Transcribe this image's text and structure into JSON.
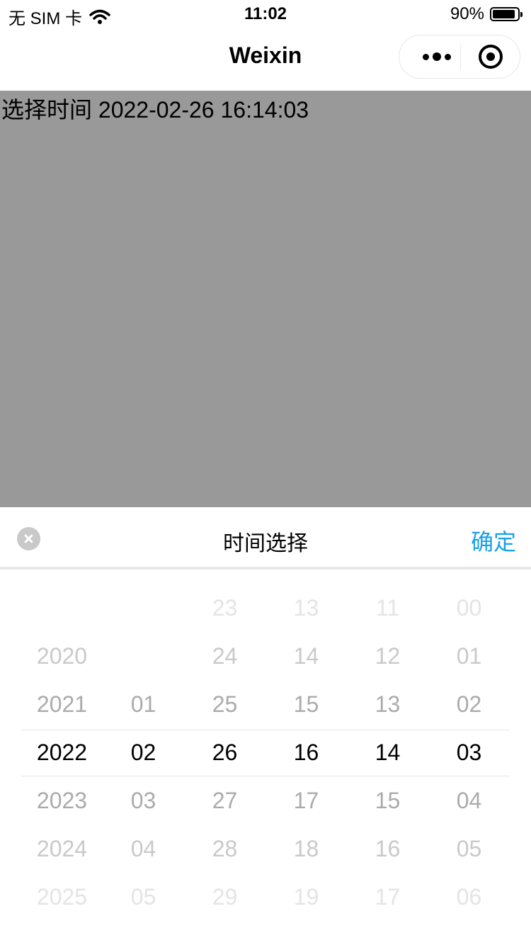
{
  "status_bar": {
    "carrier": "无 SIM 卡",
    "time": "11:02",
    "battery": "90%",
    "battery_level": 0.9
  },
  "nav": {
    "title": "Weixin"
  },
  "page": {
    "label": "选择时间",
    "value": "2022-02-26 16:14:03"
  },
  "picker": {
    "title": "时间选择",
    "confirm_label": "确定",
    "columns": [
      {
        "name": "year",
        "values": [
          "",
          "2020",
          "2021",
          "2022",
          "2023",
          "2024",
          "2025"
        ],
        "selected": "2022"
      },
      {
        "name": "month",
        "values": [
          "",
          "",
          "01",
          "02",
          "03",
          "04",
          "05"
        ],
        "selected": "02"
      },
      {
        "name": "day",
        "values": [
          "23",
          "24",
          "25",
          "26",
          "27",
          "28",
          "29"
        ],
        "selected": "26"
      },
      {
        "name": "hour",
        "values": [
          "13",
          "14",
          "15",
          "16",
          "17",
          "18",
          "19"
        ],
        "selected": "16"
      },
      {
        "name": "minute",
        "values": [
          "11",
          "12",
          "13",
          "14",
          "15",
          "16",
          "17"
        ],
        "selected": "14"
      },
      {
        "name": "second",
        "values": [
          "00",
          "01",
          "02",
          "03",
          "04",
          "05",
          "06"
        ],
        "selected": "03"
      }
    ]
  },
  "colors": {
    "accent": "#1AA0E6",
    "mask": "#999999"
  },
  "icons": [
    "wifi-icon",
    "battery-icon",
    "more-icon",
    "close-icon",
    "cancel-icon"
  ]
}
